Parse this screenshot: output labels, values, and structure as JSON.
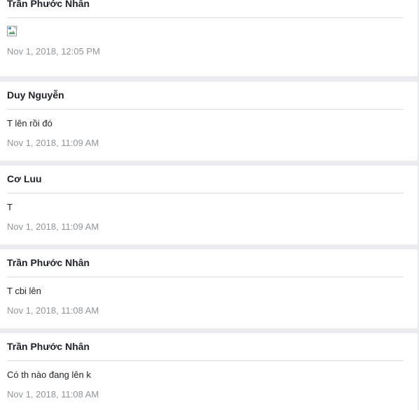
{
  "messages": [
    {
      "sender": "Trần Phước Nhân",
      "content": "",
      "content_icon": "broken-image-icon",
      "timestamp": "Nov 1, 2018, 12:05 PM"
    },
    {
      "sender": "Duy Nguyễn",
      "content": "T lên rồi đó",
      "timestamp": "Nov 1, 2018, 11:09 AM"
    },
    {
      "sender": "Cơ Luu",
      "content": "T",
      "timestamp": "Nov 1, 2018, 11:09 AM"
    },
    {
      "sender": "Trần Phước Nhân",
      "content": "T cbi lên",
      "timestamp": "Nov 1, 2018, 11:08 AM"
    },
    {
      "sender": "Trần Phước Nhân",
      "content": "Có th nào đang lên k",
      "timestamp": "Nov 1, 2018, 11:08 AM"
    }
  ]
}
